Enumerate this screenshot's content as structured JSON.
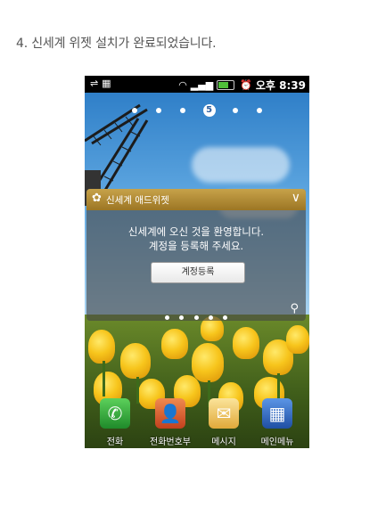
{
  "caption": "4. 신세계 위젯 설치가 완료되었습니다.",
  "statusbar": {
    "time": "오후 8:39",
    "icons": [
      "usb-icon",
      "signal-icon",
      "wifi-icon",
      "signal-bars-icon",
      "battery-icon",
      "alarm-icon"
    ]
  },
  "pager": {
    "current_page": "5"
  },
  "widget": {
    "title": "신세계 애드위젯",
    "collapse_glyph": "∨",
    "message_line1": "신세계에 오신 것을 환영합니다.",
    "message_line2": "계정을 등록해 주세요.",
    "register_button": "계정등록",
    "location_icon": "location-pin-icon"
  },
  "dock": {
    "items": [
      {
        "label": "전화",
        "icon": "phone-icon",
        "color": "#2ea043"
      },
      {
        "label": "전화번호부",
        "icon": "contacts-icon",
        "color": "#d9532b"
      },
      {
        "label": "메시지",
        "icon": "message-icon",
        "color": "#f2c14e"
      },
      {
        "label": "메인메뉴",
        "icon": "main-menu-icon",
        "color": "#2f6fc7"
      }
    ]
  }
}
